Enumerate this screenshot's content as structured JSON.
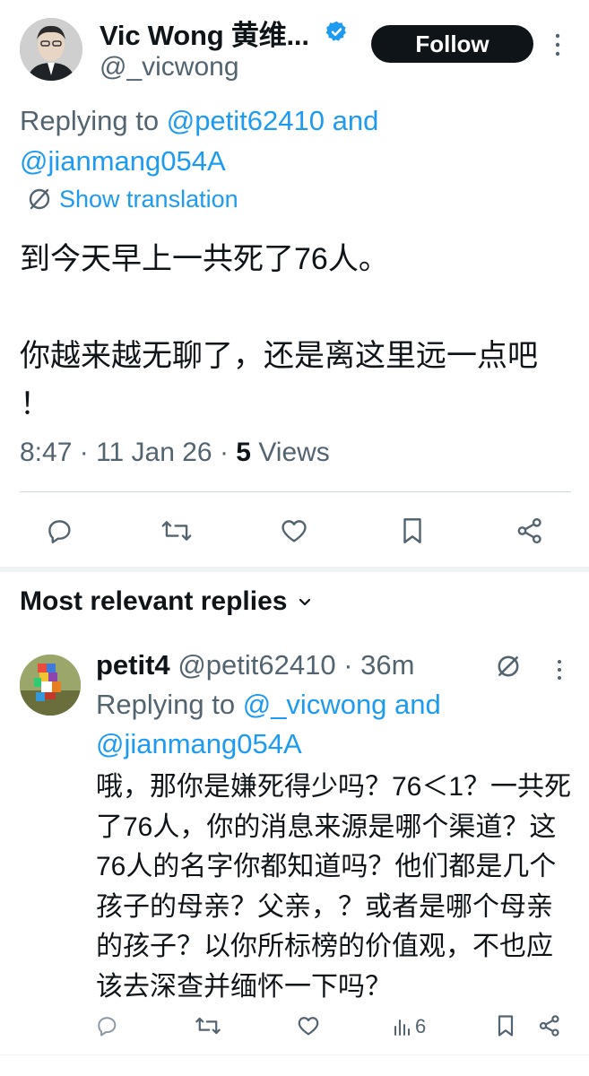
{
  "tweet": {
    "display_name": "Vic Wong 黄维...",
    "handle": "@_vicwong",
    "follow_label": "Follow",
    "replying_prefix": "Replying to ",
    "replying_user1": "@petit62410",
    "replying_and": " and",
    "replying_user2": "@jianmang054A",
    "show_translation": "Show translation",
    "text_line1": "到今天早上一共死了76人。",
    "text_line2": "你越来越无聊了，还是离这里远一点吧 ！",
    "time": "8:47",
    "date": "11 Jan 26",
    "views_count": "5",
    "views_label": "Views",
    "sep": " · "
  },
  "replies_header": {
    "label": "Most relevant replies"
  },
  "reply": {
    "name": "petit4",
    "handle": "@petit62410",
    "age": "36m",
    "sep": " · ",
    "replying_prefix": "Replying to ",
    "replying_user1": "@_vicwong",
    "replying_and": " and",
    "replying_user2": "@jianmang054A",
    "text": "哦，那你是嫌死得少吗？76＜1？一共死了76人，你的消息来源是哪个渠道？这76人的名字你都知道吗？他们都是几个孩子的母亲？父亲，？或者是哪个母亲的孩子？以你所标榜的价值观，不也应该去深查并缅怀一下吗？",
    "views_count": "6"
  },
  "colors": {
    "accent": "#1d9bf0",
    "text": "#0f1419",
    "muted": "#536471",
    "border": "#cfd9de"
  },
  "icons": [
    "verified-badge-icon",
    "more-icon",
    "translate-icon",
    "reply-icon",
    "retweet-icon",
    "like-icon",
    "bookmark-icon",
    "share-icon",
    "views-icon",
    "chevron-down-icon",
    "grok-icon"
  ]
}
